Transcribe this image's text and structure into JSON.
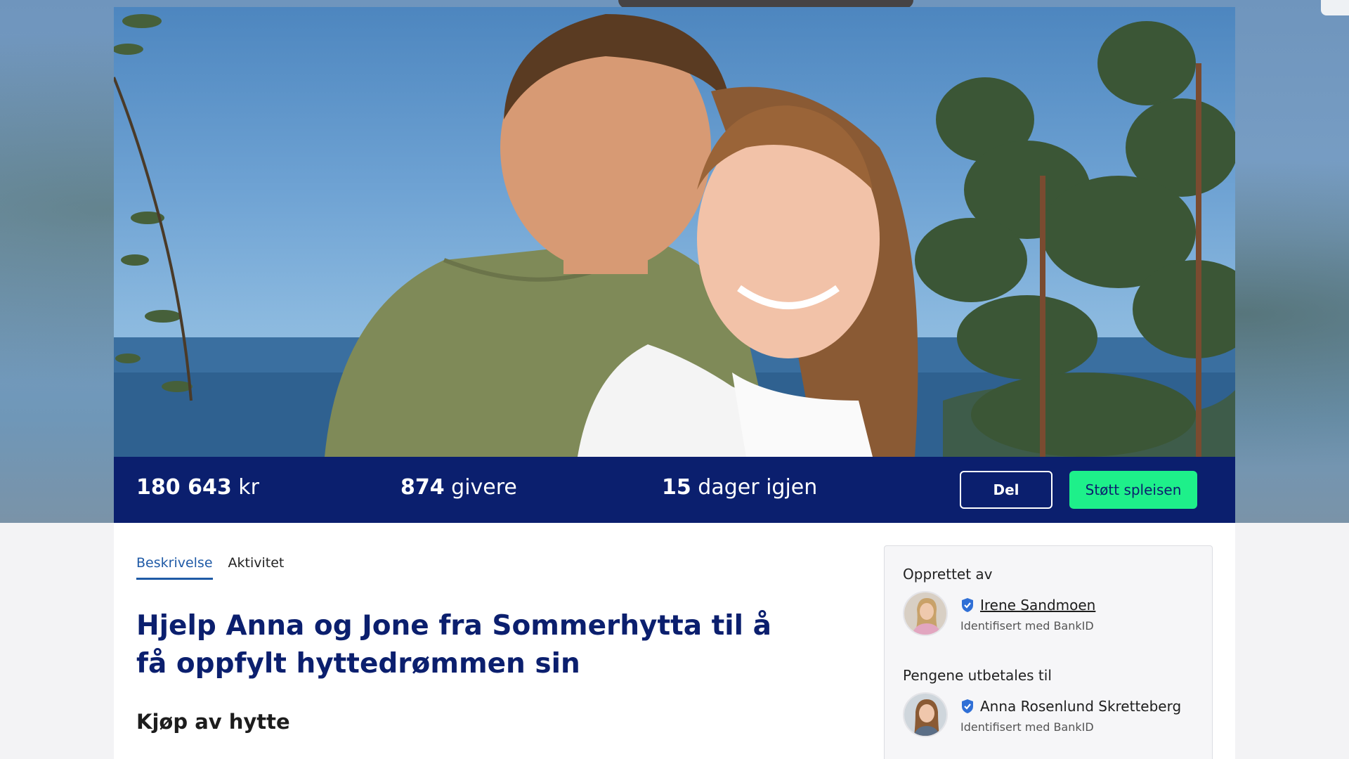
{
  "stats": {
    "amount_value": "180 643",
    "amount_unit": "kr",
    "donors_value": "874",
    "donors_unit": "givere",
    "days_value": "15",
    "days_unit": "dager igjen"
  },
  "actions": {
    "share_label": "Del",
    "support_label": "Støtt spleisen"
  },
  "tabs": [
    {
      "label": "Beskrivelse",
      "active": true
    },
    {
      "label": "Aktivitet",
      "active": false
    }
  ],
  "campaign": {
    "title": "Hjelp Anna og Jone fra Sommerhytta til å få oppfylt hyttedrømmen sin",
    "subtitle": "Kjøp av hytte"
  },
  "sidebar": {
    "created_by_heading": "Opprettet av",
    "creator": {
      "name": "Irene Sandmoen",
      "verification": "Identifisert med BankID"
    },
    "payout_heading": "Pengene utbetales til",
    "recipient": {
      "name": "Anna Rosenlund Skretteberg",
      "verification": "Identifisert med BankID"
    }
  },
  "colors": {
    "stats_bar_bg": "#0b1f6e",
    "support_button_bg": "#1ef08a",
    "title_color": "#0b1f6e",
    "verified_badge": "#2f6fd6"
  },
  "icons": {
    "verified": "verified-shield-check-icon"
  }
}
